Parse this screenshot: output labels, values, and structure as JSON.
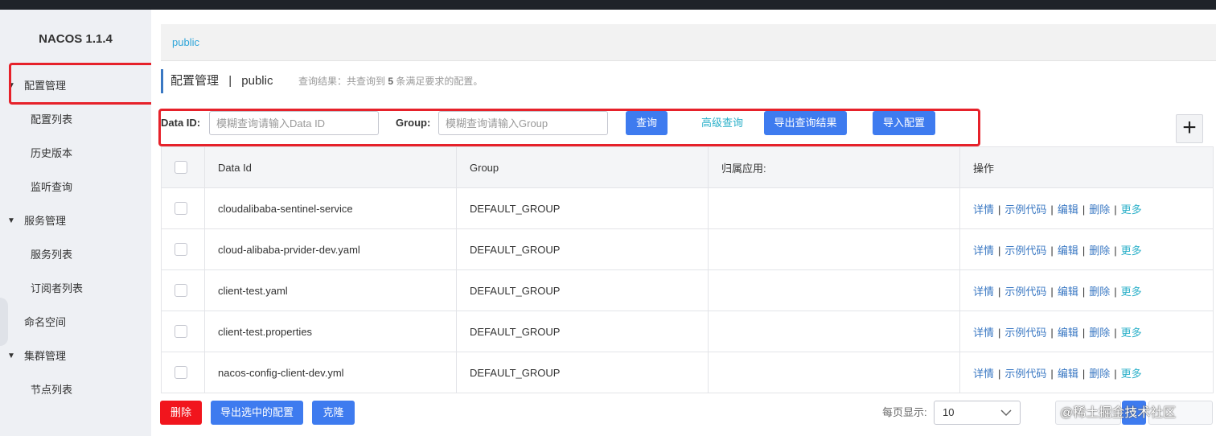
{
  "sidebar": {
    "brand": "NACOS 1.1.4",
    "items": [
      {
        "label": "配置管理",
        "level": "top",
        "expanded": true
      },
      {
        "label": "配置列表",
        "level": "sub"
      },
      {
        "label": "历史版本",
        "level": "sub"
      },
      {
        "label": "监听查询",
        "level": "sub"
      },
      {
        "label": "服务管理",
        "level": "top",
        "expanded": true
      },
      {
        "label": "服务列表",
        "level": "sub"
      },
      {
        "label": "订阅者列表",
        "level": "sub"
      },
      {
        "label": "命名空间",
        "level": "top"
      },
      {
        "label": "集群管理",
        "level": "top",
        "expanded": true
      },
      {
        "label": "节点列表",
        "level": "sub"
      }
    ]
  },
  "namespace": {
    "current": "public"
  },
  "header": {
    "title": "配置管理",
    "separator": "|",
    "namespace": "public",
    "result_prefix": "查询结果：共查询到",
    "result_count": "5",
    "result_suffix": "条满足要求的配置。"
  },
  "search": {
    "data_id_label": "Data ID:",
    "data_id_placeholder": "模糊查询请输入Data ID",
    "group_label": "Group:",
    "group_placeholder": "模糊查询请输入Group",
    "query_button": "查询",
    "advanced_link": "高级查询",
    "export_button": "导出查询结果",
    "import_button": "导入配置",
    "add_button": "+"
  },
  "table": {
    "headers": [
      "Data Id",
      "Group",
      "归属应用:",
      "操作"
    ],
    "ops": {
      "detail": "详情",
      "sample": "示例代码",
      "edit": "编辑",
      "delete": "删除",
      "more": "更多",
      "sep": "|"
    },
    "rows": [
      {
        "data_id": "cloudalibaba-sentinel-service",
        "group": "DEFAULT_GROUP",
        "app": ""
      },
      {
        "data_id": "cloud-alibaba-prvider-dev.yaml",
        "group": "DEFAULT_GROUP",
        "app": ""
      },
      {
        "data_id": "client-test.yaml",
        "group": "DEFAULT_GROUP",
        "app": ""
      },
      {
        "data_id": "client-test.properties",
        "group": "DEFAULT_GROUP",
        "app": ""
      },
      {
        "data_id": "nacos-config-client-dev.yml",
        "group": "DEFAULT_GROUP",
        "app": ""
      }
    ]
  },
  "footer": {
    "delete_button": "删除",
    "export_selected_button": "导出选中的配置",
    "clone_button": "克隆",
    "page_size_label": "每页显示:",
    "page_size_value": "10",
    "current_page": "1",
    "prev_label": "<"
  },
  "watermark": "@稀土掘金技术社区",
  "colors": {
    "primary": "#3e7bef",
    "danger": "#f1151d",
    "link": "#3a78c3",
    "accent": "#2bb0c9",
    "highlight": "#e6212a"
  }
}
